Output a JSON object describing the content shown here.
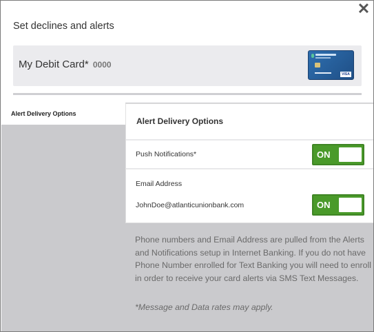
{
  "modal": {
    "title": "Set declines and alerts",
    "close_icon": "close-icon"
  },
  "card": {
    "name": "My Debit Card*",
    "number": "0000",
    "image": "debit-card-image"
  },
  "sidebar": {
    "tab_label": "Alert Delivery Options"
  },
  "panel": {
    "title": "Alert Delivery Options",
    "push_label": "Push Notifications*",
    "push_toggle": "ON",
    "email_label": "Email Address",
    "email_value": "JohnDoe@atlanticunionbank.com",
    "email_toggle": "ON"
  },
  "info": {
    "text": "Phone numbers and Email Address are pulled from the Alerts and Notifications setup in Internet Banking. If you do not have Phone Number enrolled for Text Banking you will need to enroll in order to receive your card alerts via SMS Text Messages.",
    "note": "*Message and Data rates may apply."
  },
  "colors": {
    "toggle_on": "#4a9a2a",
    "background_gray": "#cacacd"
  }
}
